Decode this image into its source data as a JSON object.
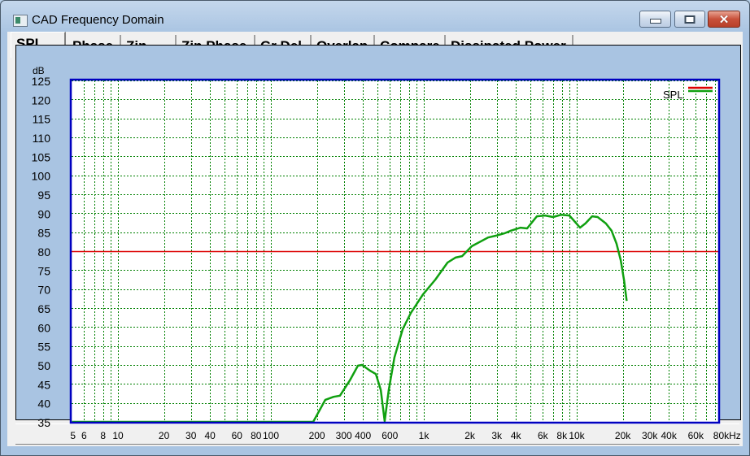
{
  "window": {
    "title": "CAD Frequency Domain",
    "buttons": {
      "minimize": "minimize",
      "maximize": "maximize",
      "close": "✕"
    }
  },
  "tabs": [
    {
      "label": "SPL",
      "active": true
    },
    {
      "label": "Phase",
      "active": false
    },
    {
      "label": "Zin",
      "active": false
    },
    {
      "label": "Zin Phase",
      "active": false
    },
    {
      "label": "Gr Del",
      "active": false
    },
    {
      "label": "Overlap",
      "active": false
    },
    {
      "label": "Compare",
      "active": false
    },
    {
      "label": "Dissipated Power",
      "active": false
    }
  ],
  "colors": {
    "background": "#a9c4e2",
    "plot_bg": "#ffffff",
    "frame": "#0000c0",
    "grid": "#008000",
    "spl_curve": "#10a010",
    "reference_line": "#dd0000"
  },
  "chart_data": {
    "type": "line",
    "title": "",
    "ylabel": "dB",
    "xlabel": "Hz",
    "xscale": "log",
    "xlim": [
      5,
      88000
    ],
    "ylim": [
      35,
      125
    ],
    "grid": true,
    "legend": {
      "position": "top-right",
      "entries": [
        "SPL"
      ]
    },
    "yticks": [
      125,
      120,
      115,
      110,
      105,
      100,
      95,
      90,
      85,
      80,
      75,
      70,
      65,
      60,
      55,
      50,
      45,
      40,
      35
    ],
    "xticks": [
      {
        "value": 5,
        "label": "5"
      },
      {
        "value": 6,
        "label": "6"
      },
      {
        "value": 8,
        "label": "8"
      },
      {
        "value": 10,
        "label": "10"
      },
      {
        "value": 20,
        "label": "20"
      },
      {
        "value": 30,
        "label": "30"
      },
      {
        "value": 40,
        "label": "40"
      },
      {
        "value": 60,
        "label": "60"
      },
      {
        "value": 80,
        "label": "80"
      },
      {
        "value": 100,
        "label": "100"
      },
      {
        "value": 200,
        "label": "200"
      },
      {
        "value": 300,
        "label": "300"
      },
      {
        "value": 400,
        "label": "400"
      },
      {
        "value": 600,
        "label": "600"
      },
      {
        "value": 1000,
        "label": "1k"
      },
      {
        "value": 2000,
        "label": "2k"
      },
      {
        "value": 3000,
        "label": "3k"
      },
      {
        "value": 4000,
        "label": "4k"
      },
      {
        "value": 6000,
        "label": "6k"
      },
      {
        "value": 8000,
        "label": "8k"
      },
      {
        "value": 10000,
        "label": "10k"
      },
      {
        "value": 20000,
        "label": "20k"
      },
      {
        "value": 30000,
        "label": "30k"
      },
      {
        "value": 40000,
        "label": "40k"
      },
      {
        "value": 60000,
        "label": "60k"
      },
      {
        "value": 80000,
        "label": "80kHz"
      }
    ],
    "grid_x": [
      6,
      7,
      8,
      9,
      10,
      20,
      30,
      40,
      50,
      60,
      70,
      80,
      90,
      100,
      200,
      300,
      400,
      500,
      600,
      700,
      800,
      900,
      1000,
      2000,
      3000,
      4000,
      5000,
      6000,
      7000,
      8000,
      9000,
      10000,
      20000,
      30000,
      40000,
      50000,
      60000,
      70000,
      80000
    ],
    "reference_line": {
      "name": "reference",
      "y": 80
    },
    "series": [
      {
        "name": "SPL",
        "x": [
          5,
          100,
          189,
          227,
          257,
          283,
          328,
          371,
          394,
          445,
          486,
          523,
          555,
          590,
          643,
          727,
          822,
          988,
          1190,
          1430,
          1610,
          1780,
          2060,
          2630,
          2970,
          3360,
          3710,
          4290,
          4740,
          5290,
          5490,
          6200,
          7000,
          7920,
          8950,
          9850,
          10500,
          11400,
          12600,
          13700,
          15500,
          16900,
          18200,
          19400,
          20400,
          21200
        ],
        "y": [
          35,
          35,
          35,
          40.8,
          41.6,
          41.9,
          45.9,
          49.8,
          50,
          48.5,
          47.6,
          43.4,
          35.2,
          43.4,
          52,
          59.4,
          63.7,
          68.6,
          72.5,
          77,
          78.3,
          78.7,
          81.3,
          83.6,
          84.1,
          84.7,
          85.4,
          86.2,
          86,
          88.4,
          89.2,
          89.4,
          89,
          89.6,
          89.4,
          87.5,
          86.2,
          87.3,
          89.2,
          89,
          87.3,
          85.4,
          82,
          77.6,
          72.3,
          66.9
        ]
      }
    ]
  }
}
